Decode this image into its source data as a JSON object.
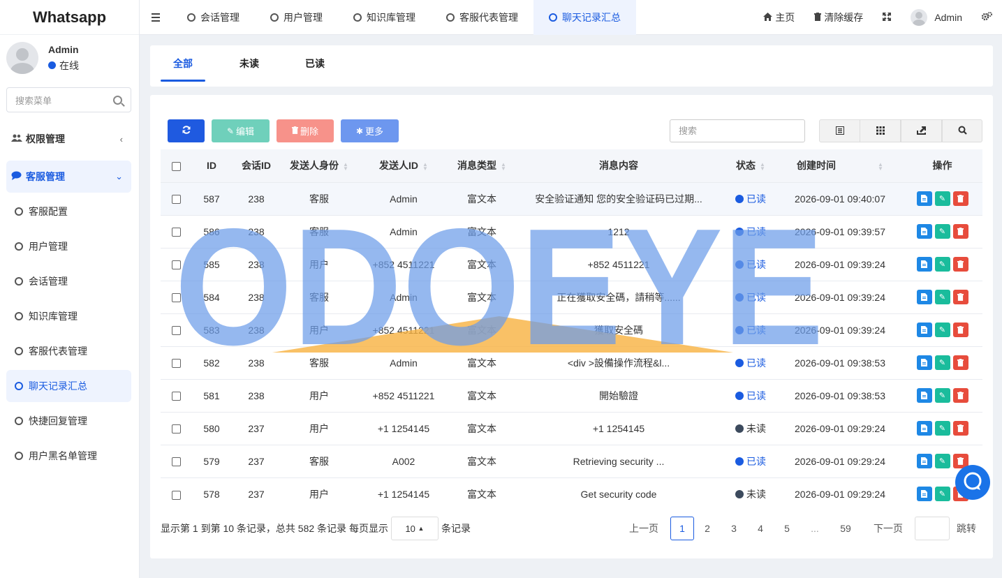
{
  "app": {
    "brand": "Whatsapp"
  },
  "user": {
    "name": "Admin",
    "status": "在线"
  },
  "sidebar": {
    "search_placeholder": "搜索菜单",
    "groups": [
      {
        "label": "权限管理",
        "icon": "users-icon"
      },
      {
        "label": "客服管理",
        "icon": "chat-bubble-icon"
      }
    ],
    "items": [
      {
        "label": "客服配置"
      },
      {
        "label": "用户管理"
      },
      {
        "label": "会话管理"
      },
      {
        "label": "知识库管理"
      },
      {
        "label": "客服代表管理"
      },
      {
        "label": "聊天记录汇总"
      },
      {
        "label": "快捷回复管理"
      },
      {
        "label": "用户黑名单管理"
      }
    ],
    "active_item": "聊天记录汇总"
  },
  "topbar": {
    "tabs": [
      "会话管理",
      "用户管理",
      "知识库管理",
      "客服代表管理",
      "聊天记录汇总"
    ],
    "active_tab": "聊天记录汇总",
    "home_label": "主页",
    "clear_cache_label": "清除缓存",
    "user_name": "Admin"
  },
  "filter_tabs": {
    "all": "全部",
    "unread": "未读",
    "read": "已读",
    "active": "全部"
  },
  "toolbar": {
    "edit_label": "编辑",
    "delete_label": "删除",
    "more_label": "更多",
    "search_placeholder": "搜索"
  },
  "table": {
    "headers": {
      "id": "ID",
      "session_id": "会话ID",
      "sender_role": "发送人身份",
      "sender_id": "发送人ID",
      "msg_type": "消息类型",
      "content": "消息内容",
      "status": "状态",
      "created": "创建时间",
      "actions": "操作"
    },
    "rows": [
      {
        "id": "587",
        "session": "238",
        "role": "客服",
        "sender": "Admin",
        "type": "富文本",
        "content": "安全验证通知 您的安全验证码已过期...",
        "status": "已读",
        "time": "2026-09-01 09:40:07"
      },
      {
        "id": "586",
        "session": "238",
        "role": "客服",
        "sender": "Admin",
        "type": "富文本",
        "content": "1212",
        "status": "已读",
        "time": "2026-09-01 09:39:57"
      },
      {
        "id": "585",
        "session": "238",
        "role": "用户",
        "sender": "+852 4511221",
        "type": "富文本",
        "content": "+852 4511221",
        "status": "已读",
        "time": "2026-09-01 09:39:24"
      },
      {
        "id": "584",
        "session": "238",
        "role": "客服",
        "sender": "Admin",
        "type": "富文本",
        "content": "正在獲取安全碼，請稍等......",
        "status": "已读",
        "time": "2026-09-01 09:39:24"
      },
      {
        "id": "583",
        "session": "238",
        "role": "用户",
        "sender": "+852 4511221",
        "type": "富文本",
        "content": "獲取安全碼",
        "status": "已读",
        "time": "2026-09-01 09:39:24"
      },
      {
        "id": "582",
        "session": "238",
        "role": "客服",
        "sender": "Admin",
        "type": "富文本",
        "content": "<div >設備操作流程&l...",
        "status": "已读",
        "time": "2026-09-01 09:38:53"
      },
      {
        "id": "581",
        "session": "238",
        "role": "用户",
        "sender": "+852 4511221",
        "type": "富文本",
        "content": "開始驗證",
        "status": "已读",
        "time": "2026-09-01 09:38:53"
      },
      {
        "id": "580",
        "session": "237",
        "role": "用户",
        "sender": "+1 1254145",
        "type": "富文本",
        "content": "+1 1254145",
        "status": "未读",
        "time": "2026-09-01 09:29:24"
      },
      {
        "id": "579",
        "session": "237",
        "role": "客服",
        "sender": "A002",
        "type": "富文本",
        "content": "Retrieving security ...",
        "status": "已读",
        "time": "2026-09-01 09:29:24"
      },
      {
        "id": "578",
        "session": "237",
        "role": "用户",
        "sender": "+1 1254145",
        "type": "富文本",
        "content": "Get security code",
        "status": "未读",
        "time": "2026-09-01 09:29:24"
      }
    ]
  },
  "pagination": {
    "info_prefix": "显示第 1 到第 10 条记录，总共 582 条记录 每页显示",
    "page_size": "10",
    "info_suffix": "条记录",
    "prev": "上一页",
    "pages": [
      "1",
      "2",
      "3",
      "4",
      "5",
      "...",
      "59"
    ],
    "current": "1",
    "next": "下一页",
    "jump": "跳转"
  },
  "watermark": {
    "text": "ODOEYE"
  },
  "colors": {
    "primary": "#1a5be0",
    "btn_refresh": "#1f5ae0",
    "btn_edit": "#6fd0bb",
    "btn_delete": "#f7928a",
    "btn_more": "#6d97ef",
    "op_view": "#1e88e5",
    "op_edit": "#1abc9c",
    "op_delete": "#e74c3c",
    "status_read": "#1a5be0",
    "status_unread": "#3c4a5d"
  }
}
